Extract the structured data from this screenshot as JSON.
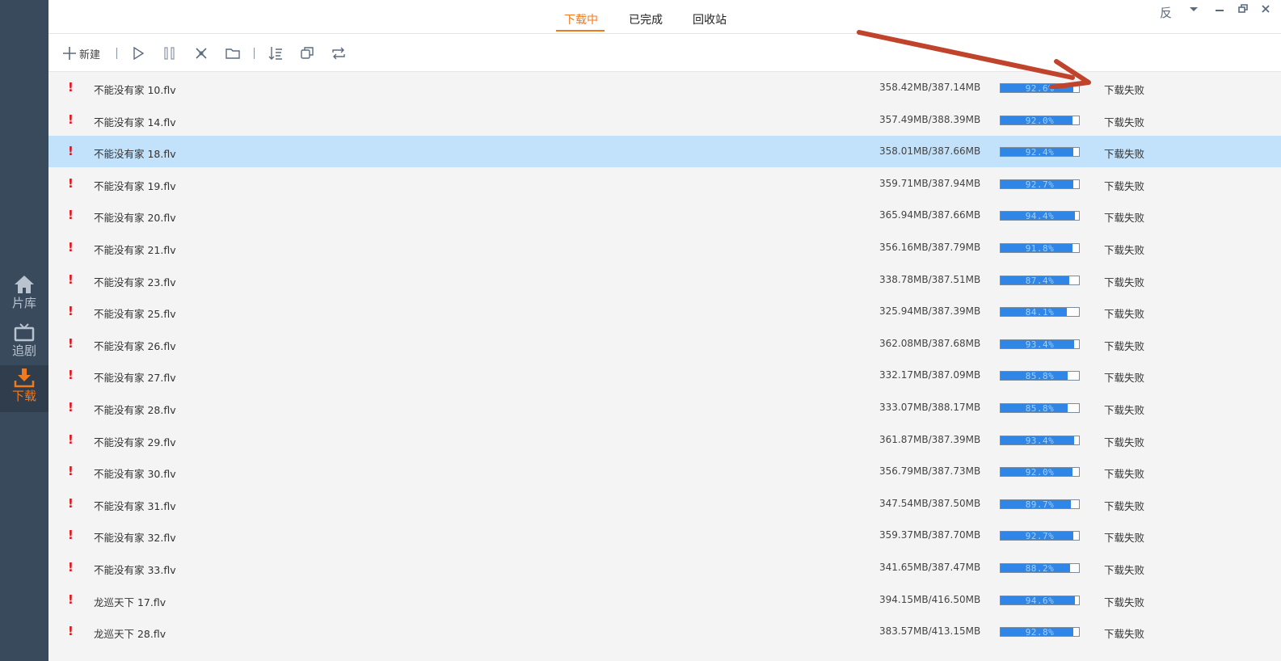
{
  "sidebar": {
    "items": [
      {
        "label": "片库",
        "icon": "home-icon"
      },
      {
        "label": "追剧",
        "icon": "tv-icon"
      },
      {
        "label": "下载",
        "icon": "download-icon"
      }
    ]
  },
  "tabs": [
    {
      "label": "下载中",
      "active": true
    },
    {
      "label": "已完成",
      "active": false
    },
    {
      "label": "回收站",
      "active": false
    }
  ],
  "window_controls": {
    "feedback_label": "反"
  },
  "toolbar": {
    "new_label": "新建"
  },
  "colors": {
    "accent": "#f07a1e",
    "progress": "#2f86e6",
    "selected_row": "#c2e1fb",
    "warning": "#e1141b",
    "arrow": "#c0432c"
  },
  "rows": [
    {
      "name": "不能没有家 10.flv",
      "size": "358.42MB/387.14MB",
      "progress": 92.6,
      "progress_text": "92.6%",
      "status": "下载失败"
    },
    {
      "name": "不能没有家 14.flv",
      "size": "357.49MB/388.39MB",
      "progress": 92.0,
      "progress_text": "92.0%",
      "status": "下载失败"
    },
    {
      "name": "不能没有家 18.flv",
      "size": "358.01MB/387.66MB",
      "progress": 92.4,
      "progress_text": "92.4%",
      "status": "下载失败",
      "selected": true
    },
    {
      "name": "不能没有家 19.flv",
      "size": "359.71MB/387.94MB",
      "progress": 92.7,
      "progress_text": "92.7%",
      "status": "下载失败"
    },
    {
      "name": "不能没有家 20.flv",
      "size": "365.94MB/387.66MB",
      "progress": 94.4,
      "progress_text": "94.4%",
      "status": "下载失败"
    },
    {
      "name": "不能没有家 21.flv",
      "size": "356.16MB/387.79MB",
      "progress": 91.8,
      "progress_text": "91.8%",
      "status": "下载失败"
    },
    {
      "name": "不能没有家 23.flv",
      "size": "338.78MB/387.51MB",
      "progress": 87.4,
      "progress_text": "87.4%",
      "status": "下载失败"
    },
    {
      "name": "不能没有家 25.flv",
      "size": "325.94MB/387.39MB",
      "progress": 84.1,
      "progress_text": "84.1%",
      "status": "下载失败"
    },
    {
      "name": "不能没有家 26.flv",
      "size": "362.08MB/387.68MB",
      "progress": 93.4,
      "progress_text": "93.4%",
      "status": "下载失败"
    },
    {
      "name": "不能没有家 27.flv",
      "size": "332.17MB/387.09MB",
      "progress": 85.8,
      "progress_text": "85.8%",
      "status": "下载失败"
    },
    {
      "name": "不能没有家 28.flv",
      "size": "333.07MB/388.17MB",
      "progress": 85.8,
      "progress_text": "85.8%",
      "status": "下载失败"
    },
    {
      "name": "不能没有家 29.flv",
      "size": "361.87MB/387.39MB",
      "progress": 93.4,
      "progress_text": "93.4%",
      "status": "下载失败"
    },
    {
      "name": "不能没有家 30.flv",
      "size": "356.79MB/387.73MB",
      "progress": 92.0,
      "progress_text": "92.0%",
      "status": "下载失败"
    },
    {
      "name": "不能没有家 31.flv",
      "size": "347.54MB/387.50MB",
      "progress": 89.7,
      "progress_text": "89.7%",
      "status": "下载失败"
    },
    {
      "name": "不能没有家 32.flv",
      "size": "359.37MB/387.70MB",
      "progress": 92.7,
      "progress_text": "92.7%",
      "status": "下载失败"
    },
    {
      "name": "不能没有家 33.flv",
      "size": "341.65MB/387.47MB",
      "progress": 88.2,
      "progress_text": "88.2%",
      "status": "下载失败"
    },
    {
      "name": "龙巡天下 17.flv",
      "size": "394.15MB/416.50MB",
      "progress": 94.6,
      "progress_text": "94.6%",
      "status": "下载失败"
    },
    {
      "name": "龙巡天下 28.flv",
      "size": "383.57MB/413.15MB",
      "progress": 92.8,
      "progress_text": "92.8%",
      "status": "下载失败"
    }
  ]
}
